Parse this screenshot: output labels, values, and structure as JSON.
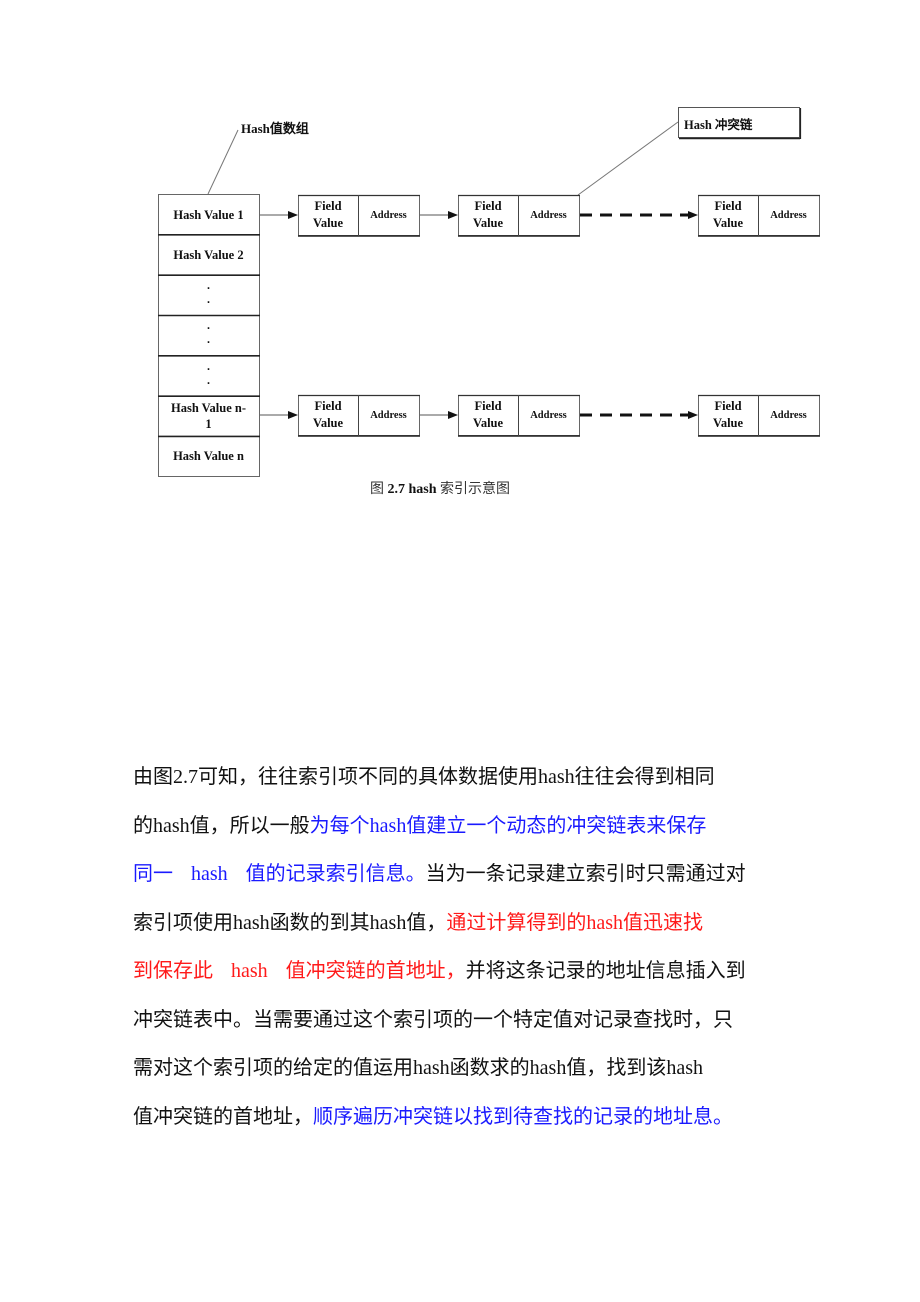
{
  "diagram": {
    "array_label": "Hash值数组",
    "chain_label": "Hash 冲突链",
    "hash_array": [
      {
        "label": "Hash Value 1"
      },
      {
        "label": "Hash Value 2"
      },
      {
        "label": "·\n·"
      },
      {
        "label": "·\n·"
      },
      {
        "label": "·\n·"
      },
      {
        "label": "Hash Value n-\n1"
      },
      {
        "label": "Hash Value n"
      }
    ],
    "node": {
      "field_label": "Field\nValue",
      "address_label": "Address"
    },
    "chains": [
      {
        "from": "Hash Value 1",
        "nodes": 3,
        "links": [
          "solid",
          "solid",
          "dashed"
        ]
      },
      {
        "from": "Hash Value n-1",
        "nodes": 3,
        "links": [
          "solid",
          "solid",
          "dashed"
        ]
      }
    ],
    "caption": {
      "prefix": "图 ",
      "number": "2.7 hash",
      "suffix": " 索引示意图"
    }
  },
  "colors": {
    "text": "#111111",
    "highlight_blue": "#1a1aff",
    "highlight_red": "#ff1a1a"
  },
  "paragraph": {
    "lines": [
      [
        {
          "t": "由图2.7可知，往往索引项不同的具体数据使用hash往往会得到相同",
          "c": "black"
        }
      ],
      [
        {
          "t": "的hash值，所以一般",
          "c": "black"
        },
        {
          "t": "为每个hash值建立一个动态的冲突链表来保存",
          "c": "blue"
        }
      ],
      [
        {
          "t": "同一",
          "c": "blue"
        },
        {
          "t": "hash",
          "c": "blue",
          "gap": true
        },
        {
          "t": "值的记录索引信息。",
          "c": "blue",
          "gap": true
        },
        {
          "t": "当为一条记录建立索引时只需通过对",
          "c": "black"
        }
      ],
      [
        {
          "t": "索引项使用hash函数的到其hash值，",
          "c": "black"
        },
        {
          "t": "通过计算得到的hash值迅速找",
          "c": "red"
        }
      ],
      [
        {
          "t": "到保存此",
          "c": "red"
        },
        {
          "t": "hash",
          "c": "red",
          "gap": true
        },
        {
          "t": "值冲突链的首地址，",
          "c": "red",
          "gap": true
        },
        {
          "t": "并将这条记录的地址信息插入到",
          "c": "black"
        }
      ],
      [
        {
          "t": "冲突链表中。当需要通过这个索引项的一个特定值对记录查找时，只",
          "c": "black"
        }
      ],
      [
        {
          "t": "需对这个索引项的给定的值运用hash函数求的hash值，找到该hash",
          "c": "black"
        }
      ],
      [
        {
          "t": "值冲突链的首地址，",
          "c": "black"
        },
        {
          "t": "顺序遍历冲突链以找到待查找的记录的地址息。",
          "c": "blue"
        }
      ]
    ]
  }
}
